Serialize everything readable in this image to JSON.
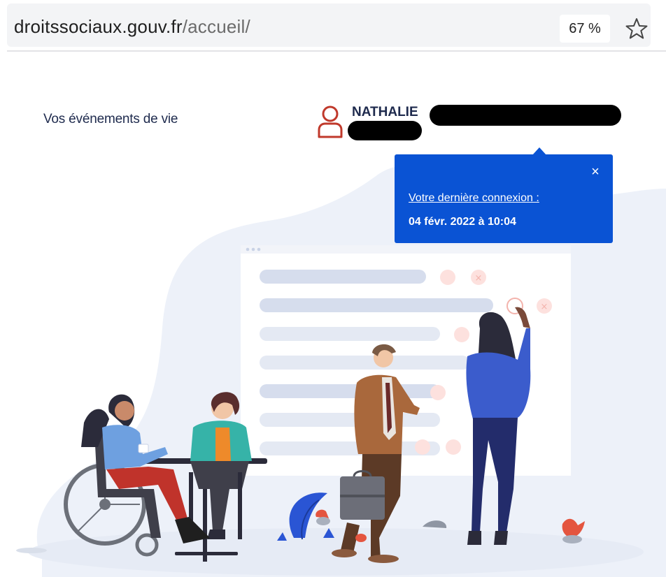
{
  "browser": {
    "url_host": "droitssociaux.gouv.fr",
    "url_path": "/accueil/",
    "zoom": "67 %",
    "bookmark_icon": "star-outline-icon"
  },
  "header": {
    "nav_link": "Vos événements de vie",
    "user_icon": "user-outline-icon",
    "user_firstname": "NATHALIE",
    "accent_color": "#c0392b"
  },
  "popover": {
    "close_label": "×",
    "label": "Votre dernière connexion :",
    "date": "04 févr. 2022 à 10:04",
    "background_color": "#0a53d4"
  }
}
